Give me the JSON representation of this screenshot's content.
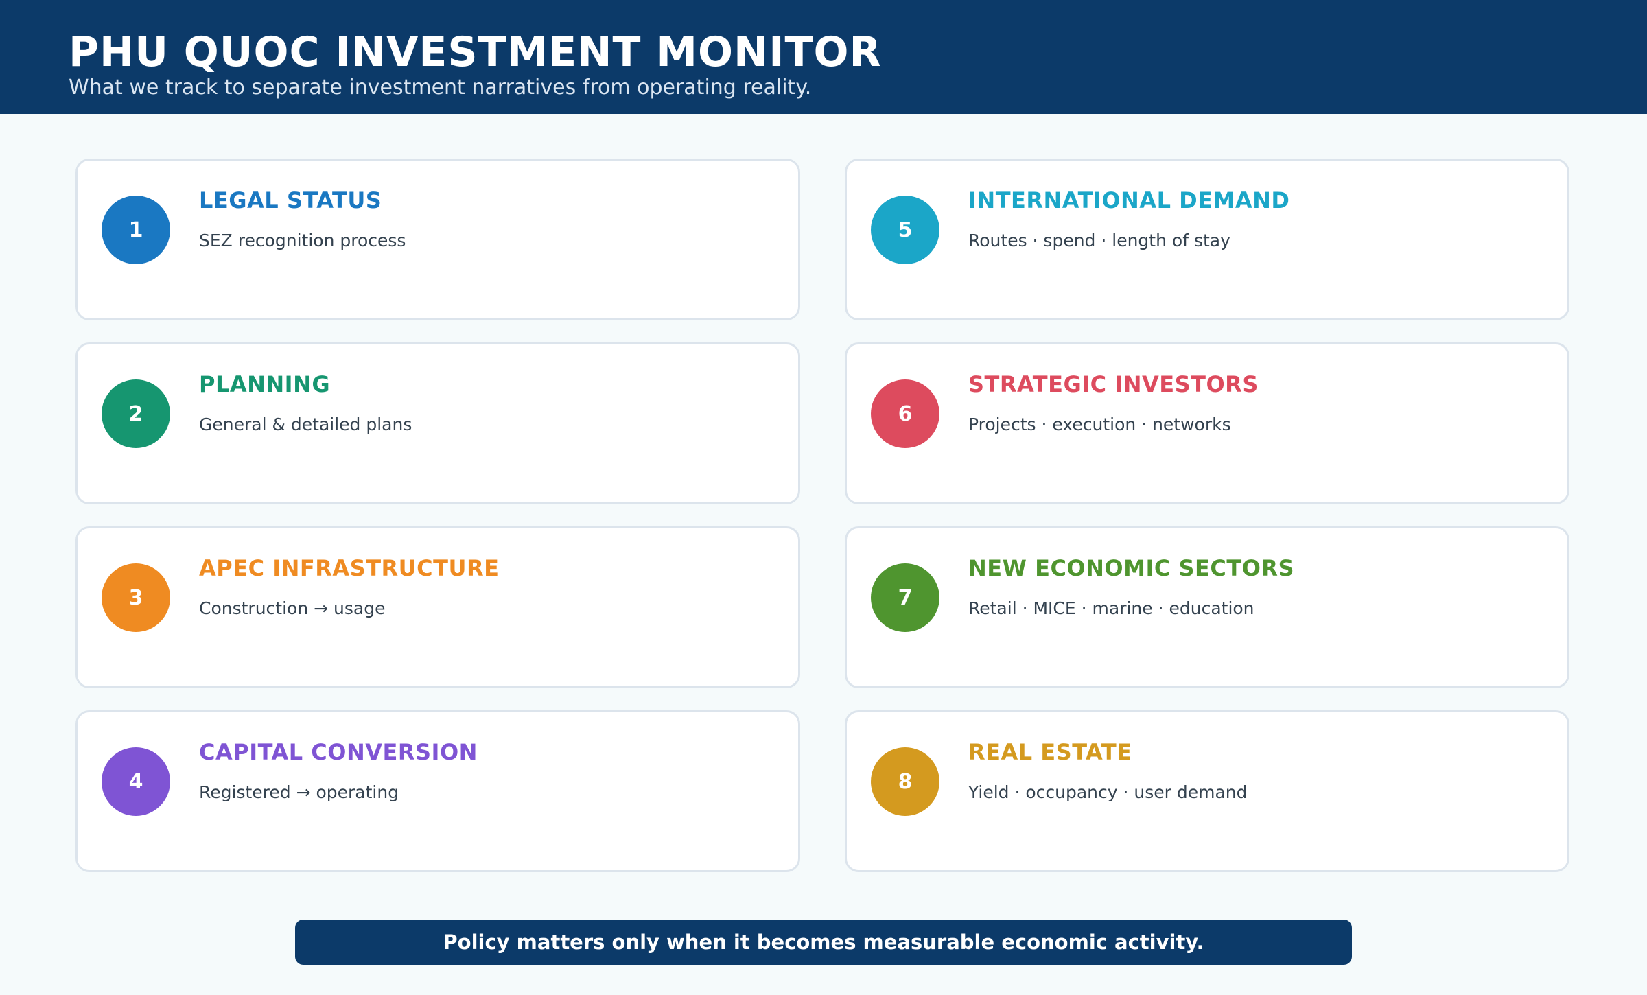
{
  "header": {
    "title": "PHU QUOC INVESTMENT MONITOR",
    "subtitle": "What we track to separate investment narratives from operating reality."
  },
  "cards": [
    {
      "number": "1",
      "title": "LEGAL STATUS",
      "description": "SEZ recognition process",
      "color": "#1a78c2"
    },
    {
      "number": "2",
      "title": "PLANNING",
      "description": "General & detailed plans",
      "color": "#169670"
    },
    {
      "number": "3",
      "title": "APEC INFRASTRUCTURE",
      "description": "Construction → usage",
      "color": "#ef8b22"
    },
    {
      "number": "4",
      "title": "CAPITAL CONVERSION",
      "description": "Registered → operating",
      "color": "#7f54d4"
    },
    {
      "number": "5",
      "title": "INTERNATIONAL DEMAND",
      "description": "Routes · spend · length of stay",
      "color": "#1ba6c8"
    },
    {
      "number": "6",
      "title": "STRATEGIC INVESTORS",
      "description": "Projects · execution · networks",
      "color": "#dd4b5e"
    },
    {
      "number": "7",
      "title": "NEW ECONOMIC SECTORS",
      "description": "Retail · MICE · marine · education",
      "color": "#4f952f"
    },
    {
      "number": "8",
      "title": "REAL ESTATE",
      "description": "Yield · occupancy · user demand",
      "color": "#d49a1f"
    }
  ],
  "footer": {
    "banner": "Policy matters only when it becomes measurable economic activity."
  }
}
